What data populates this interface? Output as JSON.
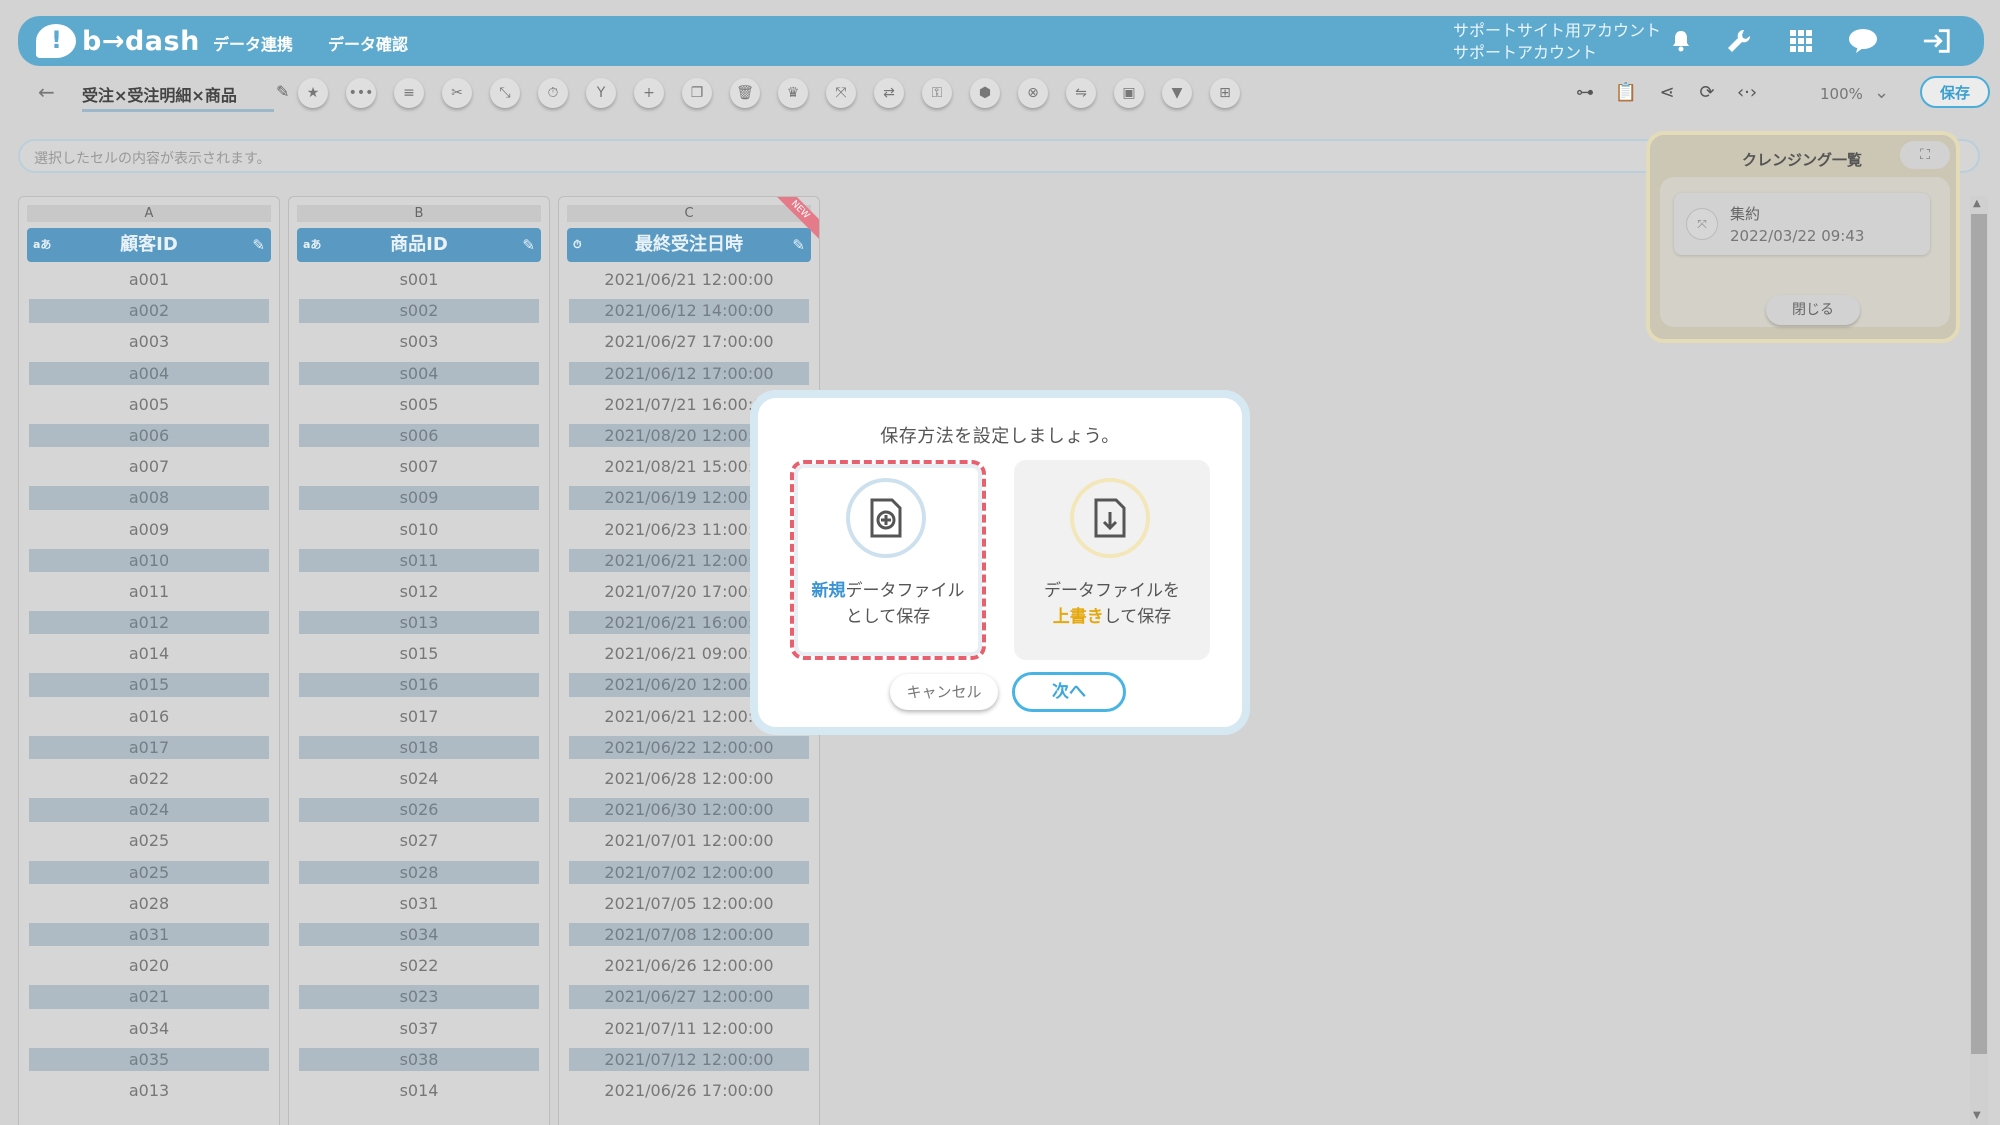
{
  "header": {
    "logo": "b→dash",
    "nav": [
      "データ連携",
      "データ確認"
    ],
    "account_line1": "サポートサイト用アカウント",
    "account_line2": "サポートアカウント",
    "icons": [
      "bell-icon",
      "wrench-icon",
      "grid-icon",
      "chat-icon",
      "logout-icon"
    ]
  },
  "toolbar": {
    "back": "←",
    "file_name": "受注×受注明細×商品",
    "zoom": "100%",
    "save_label": "保存"
  },
  "formula_bar": {
    "placeholder": "選択したセルの内容が表示されます。"
  },
  "columns": [
    {
      "letter": "A",
      "header": "顧客ID",
      "type_icon": "aあ",
      "rows": [
        "a001",
        "a002",
        "a003",
        "a004",
        "a005",
        "a006",
        "a007",
        "a008",
        "a009",
        "a010",
        "a011",
        "a012",
        "a014",
        "a015",
        "a016",
        "a017",
        "a022",
        "a024",
        "a025",
        "a025",
        "a028",
        "a031",
        "a020",
        "a021",
        "a034",
        "a035",
        "a013"
      ]
    },
    {
      "letter": "B",
      "header": "商品ID",
      "type_icon": "aあ",
      "rows": [
        "s001",
        "s002",
        "s003",
        "s004",
        "s005",
        "s006",
        "s007",
        "s009",
        "s010",
        "s011",
        "s012",
        "s013",
        "s015",
        "s016",
        "s017",
        "s018",
        "s024",
        "s026",
        "s027",
        "s028",
        "s031",
        "s034",
        "s022",
        "s023",
        "s037",
        "s038",
        "s014"
      ]
    },
    {
      "letter": "C",
      "header": "最終受注日時",
      "type_icon": "⏱",
      "badge": "NEW",
      "rows": [
        "2021/06/21 12:00:00",
        "2021/06/12 14:00:00",
        "2021/06/27 17:00:00",
        "2021/06/12 17:00:00",
        "2021/07/21 16:00:00",
        "2021/08/20 12:00:00",
        "2021/08/21 15:00:00",
        "2021/06/19 12:00:00",
        "2021/06/23 11:00:00",
        "2021/06/21 12:00:00",
        "2021/07/20 17:00:00",
        "2021/06/21 16:00:00",
        "2021/06/21 09:00:00",
        "2021/06/20 12:00:00",
        "2021/06/21 12:00:00",
        "2021/06/22 12:00:00",
        "2021/06/28 12:00:00",
        "2021/06/30 12:00:00",
        "2021/07/01 12:00:00",
        "2021/07/02 12:00:00",
        "2021/07/05 12:00:00",
        "2021/07/08 12:00:00",
        "2021/06/26 12:00:00",
        "2021/06/27 12:00:00",
        "2021/07/11 12:00:00",
        "2021/07/12 12:00:00",
        "2021/06/26 17:00:00"
      ]
    }
  ],
  "cleansing_panel": {
    "title": "クレンジング一覧",
    "item_title": "集約",
    "item_time": "2022/03/22 09:43",
    "close_label": "閉じる"
  },
  "modal": {
    "title": "保存方法を設定しましょう。",
    "option_new": {
      "highlight": "新規",
      "text1": "データファイル",
      "text2": "として保存"
    },
    "option_overwrite": {
      "text1": "データファイルを",
      "highlight": "上書き",
      "text2": "して保存"
    },
    "cancel_label": "キャンセル",
    "next_label": "次へ"
  },
  "colors": {
    "header": "#5eaace",
    "accent": "#48b4e4",
    "danger": "#e8606e",
    "overwrite": "#e5a80d"
  }
}
